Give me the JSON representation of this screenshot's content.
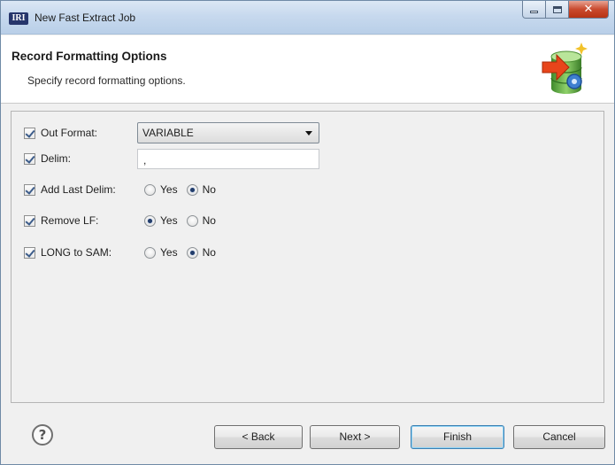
{
  "window": {
    "app_icon_text": "IRI",
    "title": "New Fast Extract Job",
    "close_symbol": "✕"
  },
  "header": {
    "title": "Record Formatting Options",
    "description": "Specify record formatting options.",
    "icon": "database-export-wizard-icon"
  },
  "form": {
    "out_format": {
      "checked": true,
      "label": "Out Format:",
      "value": "VARIABLE"
    },
    "delim": {
      "checked": true,
      "label": "Delim:",
      "value": ","
    },
    "add_last_delim": {
      "checked": true,
      "label": "Add Last Delim:",
      "yes": "Yes",
      "no": "No",
      "selected": "No"
    },
    "remove_lf": {
      "checked": true,
      "label": "Remove LF:",
      "yes": "Yes",
      "no": "No",
      "selected": "Yes"
    },
    "long_to_sam": {
      "checked": true,
      "label": "LONG to SAM:",
      "yes": "Yes",
      "no": "No",
      "selected": "No"
    }
  },
  "footer": {
    "help_symbol": "?",
    "back": "< Back",
    "next": "Next >",
    "finish": "Finish",
    "cancel": "Cancel",
    "default_button": "Finish"
  },
  "colors": {
    "titlebar": "#c7d9ee",
    "close_button": "#c94a2e",
    "accent_check": "#3c5c8a",
    "default_button_border": "#3c7fb1"
  }
}
